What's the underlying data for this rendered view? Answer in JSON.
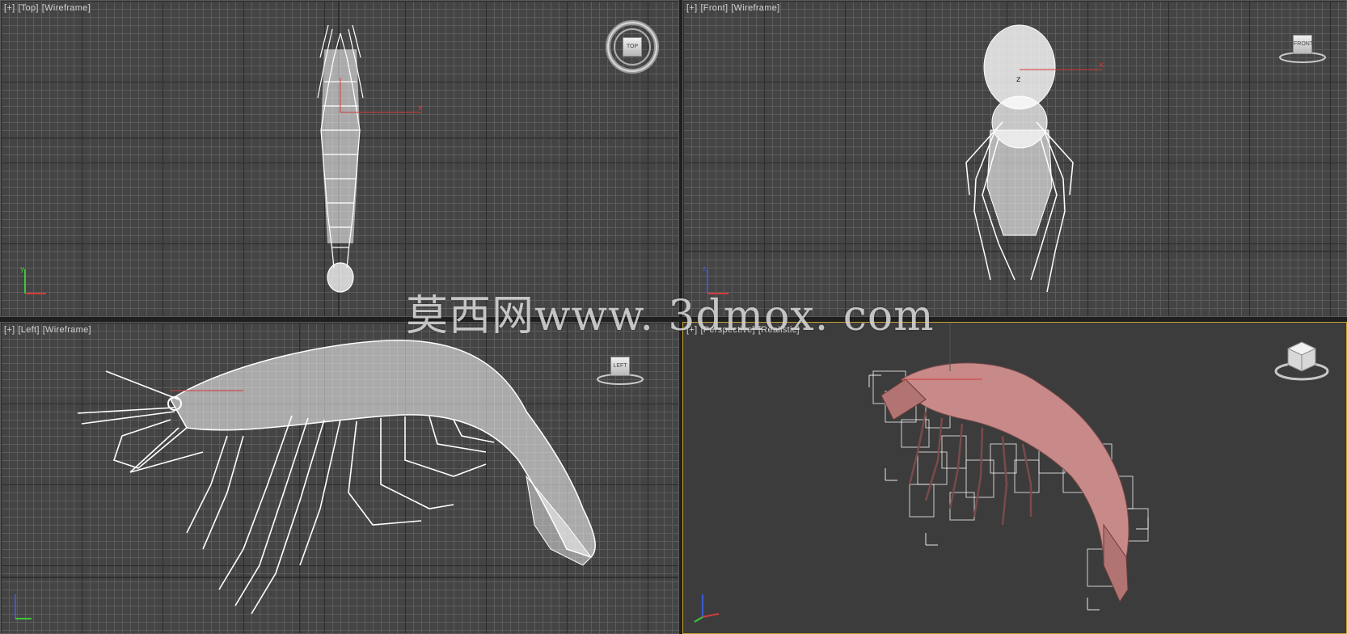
{
  "viewports": {
    "top": {
      "bracket": "[+]",
      "view": "[Top]",
      "mode": "[Wireframe]",
      "cube_label": "TOP"
    },
    "front": {
      "bracket": "[+]",
      "view": "[Front]",
      "mode": "[Wireframe]",
      "cube_label": "FRONT"
    },
    "left": {
      "bracket": "[+]",
      "view": "[Left]",
      "mode": "[Wireframe]",
      "cube_label": "LEFT"
    },
    "perspective": {
      "bracket": "[+]",
      "view": "[Perspective]",
      "mode": "[Realistic]"
    }
  },
  "watermark": "莫西网www. 3dmox. com",
  "colors": {
    "viewport_bg": "#444444",
    "perspective_bg": "#3c3c3c",
    "wireframe": "#ffffff",
    "shrimp_shaded": "#c88a88",
    "active_border": "#c9a232",
    "axis_x": "#d23c3c",
    "axis_y": "#3cc83c",
    "axis_z": "#3c5ad2"
  },
  "icons": [
    "viewcube-icon",
    "axis-tripod-icon",
    "shrimp-model"
  ]
}
